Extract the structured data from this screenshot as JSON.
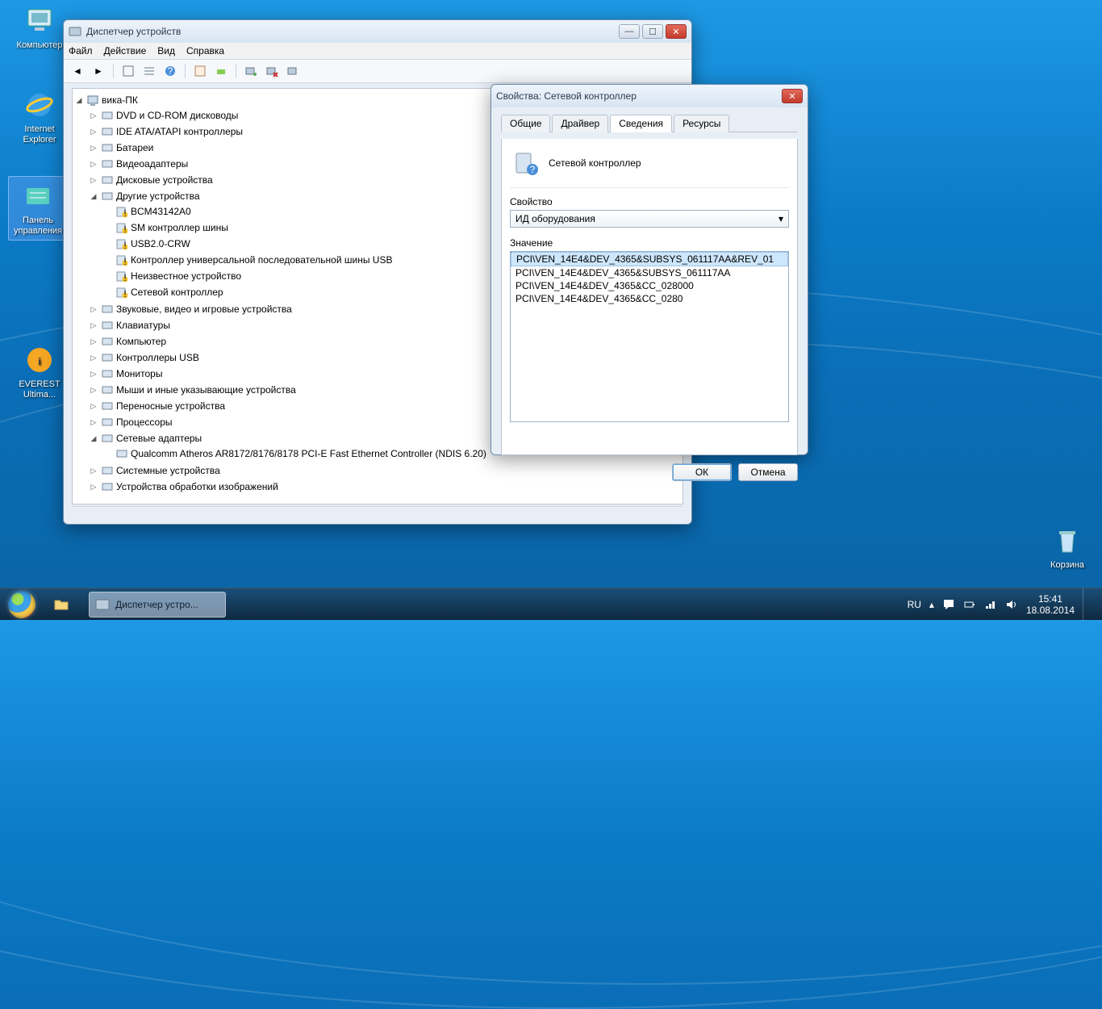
{
  "desktop_icons": [
    {
      "name": "computer-icon",
      "label": "Компьютер"
    },
    {
      "name": "ie-icon",
      "label": "Internet Explorer"
    },
    {
      "name": "control-panel-icon",
      "label": "Панель управления"
    },
    {
      "name": "everest-icon",
      "label": "EVEREST Ultima..."
    },
    {
      "name": "recycle-bin-icon",
      "label": "Корзина"
    }
  ],
  "device_manager": {
    "title": "Диспетчер устройств",
    "menu": {
      "file": "Файл",
      "action": "Действие",
      "view": "Вид",
      "help": "Справка"
    },
    "root": "вика-ПК",
    "categories": [
      {
        "icon": "disc-icon",
        "label": "DVD и CD-ROM дисководы"
      },
      {
        "icon": "ide-icon",
        "label": "IDE ATA/ATAPI контроллеры"
      },
      {
        "icon": "battery-icon",
        "label": "Батареи"
      },
      {
        "icon": "display-icon",
        "label": "Видеоадаптеры"
      },
      {
        "icon": "disk-icon",
        "label": "Дисковые устройства"
      },
      {
        "icon": "unknown-device-icon",
        "label": "Другие устройства",
        "expanded": true,
        "children": [
          {
            "label": "BCM43142A0"
          },
          {
            "label": "SM контроллер шины"
          },
          {
            "label": "USB2.0-CRW"
          },
          {
            "label": "Контроллер универсальной последовательной шины USB"
          },
          {
            "label": "Неизвестное устройство"
          },
          {
            "label": "Сетевой контроллер"
          }
        ]
      },
      {
        "icon": "audio-icon",
        "label": "Звуковые, видео и игровые устройства"
      },
      {
        "icon": "keyboard-icon",
        "label": "Клавиатуры"
      },
      {
        "icon": "computer-tree-icon",
        "label": "Компьютер"
      },
      {
        "icon": "usb-icon",
        "label": "Контроллеры USB"
      },
      {
        "icon": "monitor-icon",
        "label": "Мониторы"
      },
      {
        "icon": "mouse-icon",
        "label": "Мыши и иные указывающие устройства"
      },
      {
        "icon": "portable-icon",
        "label": "Переносные устройства"
      },
      {
        "icon": "cpu-icon",
        "label": "Процессоры"
      },
      {
        "icon": "network-icon",
        "label": "Сетевые адаптеры",
        "expanded": true,
        "children": [
          {
            "label": "Qualcomm Atheros AR8172/8176/8178 PCI-E Fast Ethernet Controller (NDIS 6.20)",
            "icon": "network-icon",
            "ok": true
          }
        ]
      },
      {
        "icon": "system-icon",
        "label": "Системные устройства"
      },
      {
        "icon": "imaging-icon",
        "label": "Устройства обработки изображений"
      }
    ]
  },
  "properties": {
    "title": "Свойства: Сетевой контроллер",
    "tabs": {
      "general": "Общие",
      "driver": "Драйвер",
      "details": "Сведения",
      "resources": "Ресурсы"
    },
    "device_name": "Сетевой контроллер",
    "property_label": "Свойство",
    "property_value": "ИД оборудования",
    "value_label": "Значение",
    "values": [
      "PCI\\VEN_14E4&DEV_4365&SUBSYS_061117AA&REV_01",
      "PCI\\VEN_14E4&DEV_4365&SUBSYS_061117AA",
      "PCI\\VEN_14E4&DEV_4365&CC_028000",
      "PCI\\VEN_14E4&DEV_4365&CC_0280"
    ],
    "ok": "ОК",
    "cancel": "Отмена"
  },
  "taskbar": {
    "active_app": "Диспетчер устро...",
    "lang": "RU",
    "time": "15:41",
    "date": "18.08.2014"
  }
}
